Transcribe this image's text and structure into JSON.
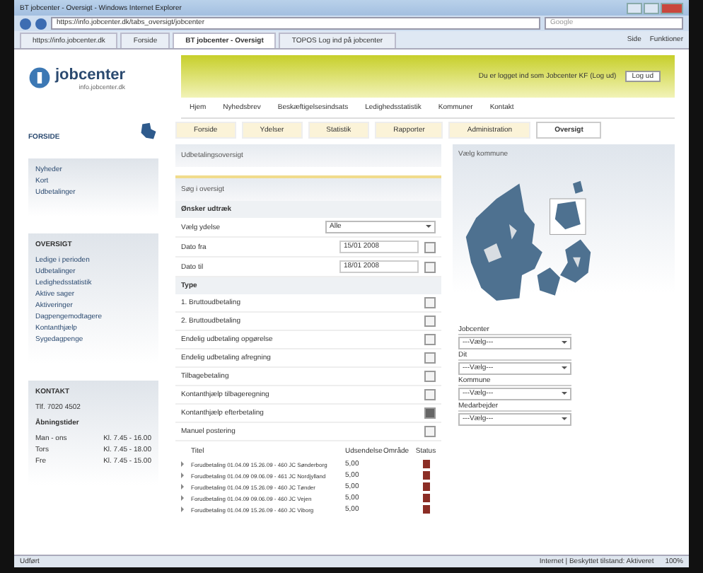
{
  "browser": {
    "title": "BT jobcenter - Oversigt - Windows Internet Explorer",
    "address": "https://info.jobcenter.dk/tabs_oversigt/jobcenter",
    "search_placeholder": "Google",
    "tabs": [
      {
        "label": "https://info.jobcenter.dk",
        "selected": false
      },
      {
        "label": "Forside",
        "selected": false
      },
      {
        "label": "BT jobcenter - Oversigt",
        "selected": true
      },
      {
        "label": "TOPOS Log ind på jobcenter",
        "selected": false
      }
    ],
    "tools": [
      "Side",
      "Funktioner"
    ],
    "status_left": "Udført",
    "status_right": "Internet | Beskyttet tilstand: Aktiveret",
    "zoom": "100%"
  },
  "header": {
    "logo_text": "jobcenter",
    "logo_sub": "info.jobcenter.dk",
    "login_text": "Du er logget ind som Jobcenter KF (Log ud)",
    "logout": "Log ud",
    "nav": [
      "Hjem",
      "Nyhedsbrev",
      "Beskæftigelsesindsats",
      "Ledighedsstatistik",
      "Kommuner",
      "Kontakt"
    ]
  },
  "page_tabs": [
    {
      "label": "Forside",
      "selected": false
    },
    {
      "label": "Ydelser",
      "selected": false
    },
    {
      "label": "Statistik",
      "selected": false
    },
    {
      "label": "Rapporter",
      "selected": false
    },
    {
      "label": "Administration",
      "selected": false
    },
    {
      "label": "Oversigt",
      "selected": true
    }
  ],
  "sidebar": {
    "title": "FORSIDE",
    "links": [
      "Nyheder",
      "Kort",
      "Udbetalinger"
    ],
    "box_title": "OVERSIGT",
    "box_links": [
      "Ledige i perioden",
      "Udbetalinger",
      "Ledighedsstatistik",
      "Aktive sager",
      "Aktiveringer",
      "Dagpengemodtagere",
      "Kontanthjælp",
      "Sygedagpenge"
    ],
    "contact": {
      "title": "KONTAKT",
      "phone": "Tlf. 7020 4502",
      "hours_title": "Åbningstider",
      "hours": [
        {
          "day": "Man - ons",
          "time": "Kl. 7.45 - 16.00"
        },
        {
          "day": "Tors",
          "time": "Kl. 7.45 - 18.00"
        },
        {
          "day": "Fre",
          "time": "Kl. 7.45 - 15.00"
        }
      ]
    }
  },
  "search_panel": {
    "title": "Udbetalingsoversigt"
  },
  "form_panel": {
    "title": "Søg i oversigt",
    "heading": "Ønsker udtræk",
    "fields": [
      {
        "label": "Vælg ydelse",
        "value": "Alle",
        "kind": "select"
      },
      {
        "label": "Dato fra",
        "value": "15/01 2008",
        "kind": "date"
      },
      {
        "label": "Dato til",
        "value": "18/01 2008",
        "kind": "date"
      }
    ],
    "type_heading": "Type",
    "types": [
      {
        "label": "1. Bruttoudbetaling",
        "checked": false
      },
      {
        "label": "2. Bruttoudbetaling",
        "checked": false
      },
      {
        "label": "Endelig udbetaling opgørelse",
        "checked": false
      },
      {
        "label": "Endelig udbetaling afregning",
        "checked": false
      },
      {
        "label": "Tilbagebetaling",
        "checked": false
      },
      {
        "label": "Kontanthjælp tilbageregning",
        "checked": false
      },
      {
        "label": "Kontanthjælp efterbetaling",
        "checked": true
      },
      {
        "label": "Manuel postering",
        "checked": false
      }
    ],
    "columns": [
      "Titel",
      "Udsendelse",
      "Område",
      "Status"
    ],
    "rows": [
      [
        "Forudbetaling 01.04.09 15.26.09 - 460 JC Sønderborg",
        "5,00"
      ],
      [
        "Forudbetaling 01.04.09 09.06.09 - 461 JC Nordjylland",
        "5,00"
      ],
      [
        "Forudbetaling 01.04.09 15.26.09 - 460 JC Tønder",
        "5,00"
      ],
      [
        "Forudbetaling 01.04.09 09.06.09 - 460 JC Vejen",
        "5,00"
      ],
      [
        "Forudbetaling 01.04.09 15.26.09 - 460 JC Viborg",
        "5,00"
      ]
    ]
  },
  "map_panel": {
    "title": "Vælg kommune",
    "filters": [
      {
        "label": "Jobcenter",
        "value": "---Vælg---"
      },
      {
        "label": "Dit",
        "value": "---Vælg---"
      },
      {
        "label": "Kommune",
        "value": "---Vælg---"
      },
      {
        "label": "Medarbejder",
        "value": "---Vælg---"
      }
    ]
  }
}
